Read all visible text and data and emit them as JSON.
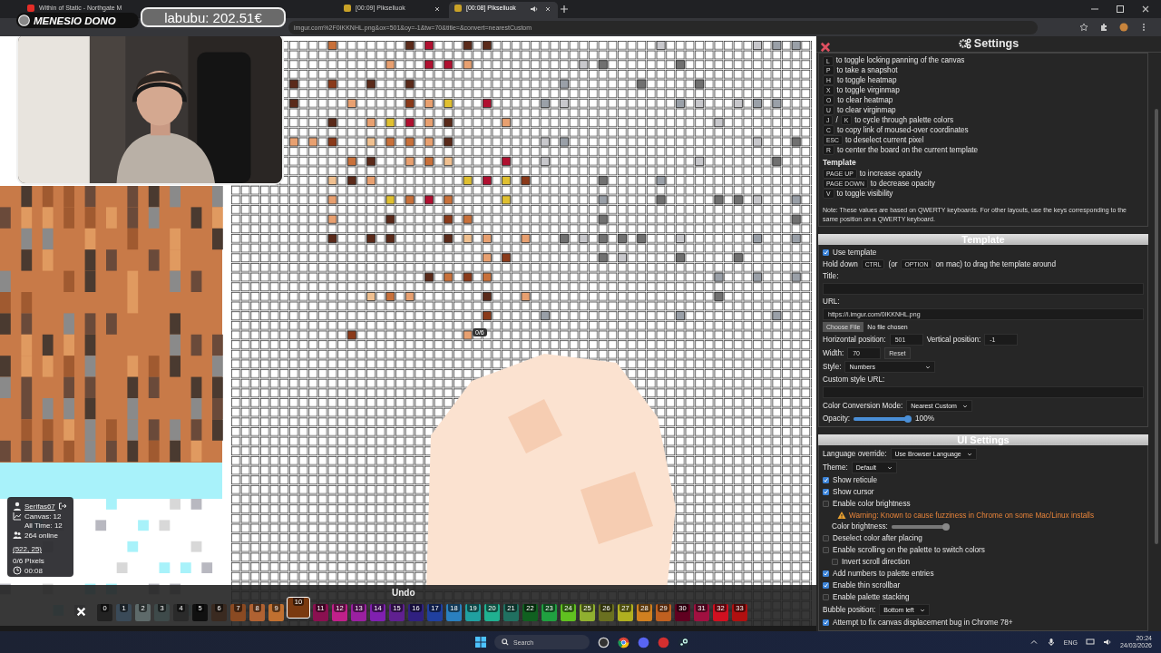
{
  "browser": {
    "tabs": [
      {
        "title": "Within of Static - Northgate M",
        "selected": false,
        "audio": false
      },
      {
        "title": "[00:09] Pikseliuok",
        "selected": false,
        "audio": false,
        "close_button": true
      },
      {
        "title": "[00:08] Pikseliuok",
        "selected": true,
        "audio": true,
        "close_button": true
      }
    ],
    "address": "imgur.com%2F0IKKNHL.png&ox=501&oy=-1&tw=70&title=&convert=nearestCustom"
  },
  "stream_overlay": {
    "donation_label": "MENESIO DONO",
    "top_donor": "labubu: 202.51€"
  },
  "canvas": {
    "cursor_bubble": "0/6"
  },
  "user_panel": {
    "username": "Serifas67",
    "canvas_count": "Canvas: 12",
    "all_time": "All Time: 12",
    "online": "264 online",
    "coords": "(522, 25)",
    "pixels": "0/6 Pixels",
    "timer": "00:08"
  },
  "palette": {
    "undo": "Undo",
    "colors": [
      {
        "label": "0",
        "color": "#222222",
        "selected": false
      },
      {
        "label": "1",
        "color": "#3a4a58",
        "selected": false
      },
      {
        "label": "2",
        "color": "#5e6a6a",
        "selected": false
      },
      {
        "label": "3",
        "color": "#3e4a4a",
        "selected": false
      },
      {
        "label": "4",
        "color": "#2a2a2a",
        "selected": false
      },
      {
        "label": "5",
        "color": "#101010",
        "selected": false
      },
      {
        "label": "6",
        "color": "#3a2a20",
        "selected": false
      },
      {
        "label": "7",
        "color": "#8a4a22",
        "selected": false
      },
      {
        "label": "8",
        "color": "#b06232",
        "selected": false
      },
      {
        "label": "9",
        "color": "#c07030",
        "selected": false
      },
      {
        "label": "10",
        "color": "#7a3a10",
        "selected": true
      },
      {
        "label": "11",
        "color": "#8a1050",
        "selected": false
      },
      {
        "label": "12",
        "color": "#c0208a",
        "selected": false
      },
      {
        "label": "13",
        "color": "#9a20a0",
        "selected": false
      },
      {
        "label": "14",
        "color": "#8020b0",
        "selected": false
      },
      {
        "label": "15",
        "color": "#602090",
        "selected": false
      },
      {
        "label": "16",
        "color": "#302080",
        "selected": false
      },
      {
        "label": "17",
        "color": "#2040a0",
        "selected": false
      },
      {
        "label": "18",
        "color": "#2a80c0",
        "selected": false
      },
      {
        "label": "19",
        "color": "#20a0a0",
        "selected": false
      },
      {
        "label": "20",
        "color": "#20b090",
        "selected": false
      },
      {
        "label": "21",
        "color": "#207060",
        "selected": false
      },
      {
        "label": "22",
        "color": "#106020",
        "selected": false
      },
      {
        "label": "23",
        "color": "#20a040",
        "selected": false
      },
      {
        "label": "24",
        "color": "#60c020",
        "selected": false
      },
      {
        "label": "25",
        "color": "#90b030",
        "selected": false
      },
      {
        "label": "26",
        "color": "#6a7020",
        "selected": false
      },
      {
        "label": "27",
        "color": "#b0b020",
        "selected": false
      },
      {
        "label": "28",
        "color": "#d08020",
        "selected": false
      },
      {
        "label": "29",
        "color": "#c06020",
        "selected": false
      },
      {
        "label": "30",
        "color": "#600020",
        "selected": false
      },
      {
        "label": "31",
        "color": "#a01040",
        "selected": false
      },
      {
        "label": "32",
        "color": "#d01020",
        "selected": false
      },
      {
        "label": "33",
        "color": "#b01010",
        "selected": false
      }
    ]
  },
  "settings": {
    "title": "Settings",
    "keybinds": [
      {
        "keys": [
          "L"
        ],
        "text": "to toggle locking panning of the canvas"
      },
      {
        "keys": [
          "P"
        ],
        "text": "to take a snapshot"
      },
      {
        "keys": [
          "H"
        ],
        "text": "to toggle heatmap"
      },
      {
        "keys": [
          "X"
        ],
        "text": "to toggle virginmap"
      },
      {
        "keys": [
          "O"
        ],
        "text": "to clear heatmap"
      },
      {
        "keys": [
          "U"
        ],
        "text": "to clear virginmap"
      },
      {
        "keys": [
          "J",
          "K"
        ],
        "joiner": "/",
        "text": "to cycle through palette colors"
      },
      {
        "keys": [
          "C"
        ],
        "text": "to copy link of moused-over coordinates"
      },
      {
        "keys": [
          "ESC"
        ],
        "text": "to deselect current pixel"
      },
      {
        "keys": [
          "R"
        ],
        "text": "to center the board on the current template"
      }
    ],
    "template_keys_heading": "Template",
    "template_keybinds": [
      {
        "keys": [
          "PAGE UP"
        ],
        "text": "to increase opacity"
      },
      {
        "keys": [
          "PAGE DOWN"
        ],
        "text": "to decrease opacity"
      },
      {
        "keys": [
          "V"
        ],
        "text": "to toggle visibility"
      }
    ],
    "note": "Note: These values are based on QWERTY keyboards. For other layouts, use the keys corresponding to the same position on a QWERTY keyboard.",
    "template": {
      "heading": "Template",
      "use_template": {
        "label": "Use template",
        "checked": true
      },
      "hold_hint": [
        {
          "kind": "text",
          "text": "Hold down"
        },
        {
          "kind": "key",
          "text": "CTRL"
        },
        {
          "kind": "text",
          "text": "(or"
        },
        {
          "kind": "key",
          "text": "OPTION"
        },
        {
          "kind": "text",
          "text": "on mac) to drag the template around"
        }
      ],
      "title_label": "Title:",
      "url_label": "URL:",
      "url_value": "https://i.imgur.com/0IKKNHL.png",
      "choose_file": "Choose File",
      "no_file": "No file chosen",
      "horizontal_label": "Horizontal position:",
      "horizontal_value": "501",
      "vertical_label": "Vertical position:",
      "vertical_value": "-1",
      "width_label": "Width:",
      "width_value": "70",
      "reset": "Reset",
      "style_label": "Style:",
      "style_value": "Numbers",
      "custom_style_label": "Custom style URL:",
      "conversion_label": "Color Conversion Mode:",
      "conversion_value": "Nearest Custom",
      "opacity_label": "Opacity:",
      "opacity": {
        "level": 1
      },
      "opacity_reading": "100%"
    },
    "ui": {
      "heading": "UI Settings",
      "language_label": "Language override:",
      "language_value": "Use Browser Language",
      "theme_label": "Theme:",
      "theme_value": "Default",
      "options": [
        {
          "kind": "checkbox",
          "label": "Show reticule",
          "checked": true
        },
        {
          "kind": "checkbox",
          "label": "Show cursor",
          "checked": true
        },
        {
          "kind": "checkbox",
          "label": "Enable color brightness",
          "checked": false
        },
        {
          "kind": "warning",
          "text": "Warning: Known to cause fuzziness in Chrome on some Mac/Linux installs"
        },
        {
          "kind": "slider",
          "label": "Color brightness:",
          "level": 1,
          "disabled": true
        },
        {
          "kind": "checkbox",
          "label": "Deselect color after placing",
          "checked": false
        },
        {
          "kind": "checkbox",
          "label": "Enable scrolling on the palette to switch colors",
          "checked": false,
          "children": [
            {
              "kind": "checkbox",
              "label": "Invert scroll direction",
              "checked": false
            }
          ]
        },
        {
          "kind": "checkbox",
          "label": "Add numbers to palette entries",
          "checked": true
        },
        {
          "kind": "checkbox",
          "label": "Enable thin scrollbar",
          "checked": true
        },
        {
          "kind": "checkbox",
          "label": "Enable palette stacking",
          "checked": false
        }
      ],
      "bubble_label": "Bubble position:",
      "bubble_value": "Bottom left",
      "fix_option": {
        "label": "Attempt to fix canvas displacement bug in Chrome 78+",
        "checked": true
      }
    }
  },
  "taskbar": {
    "search_placeholder": "Search",
    "language": "ENG",
    "time": "20:24",
    "date": "24/03/2026"
  }
}
